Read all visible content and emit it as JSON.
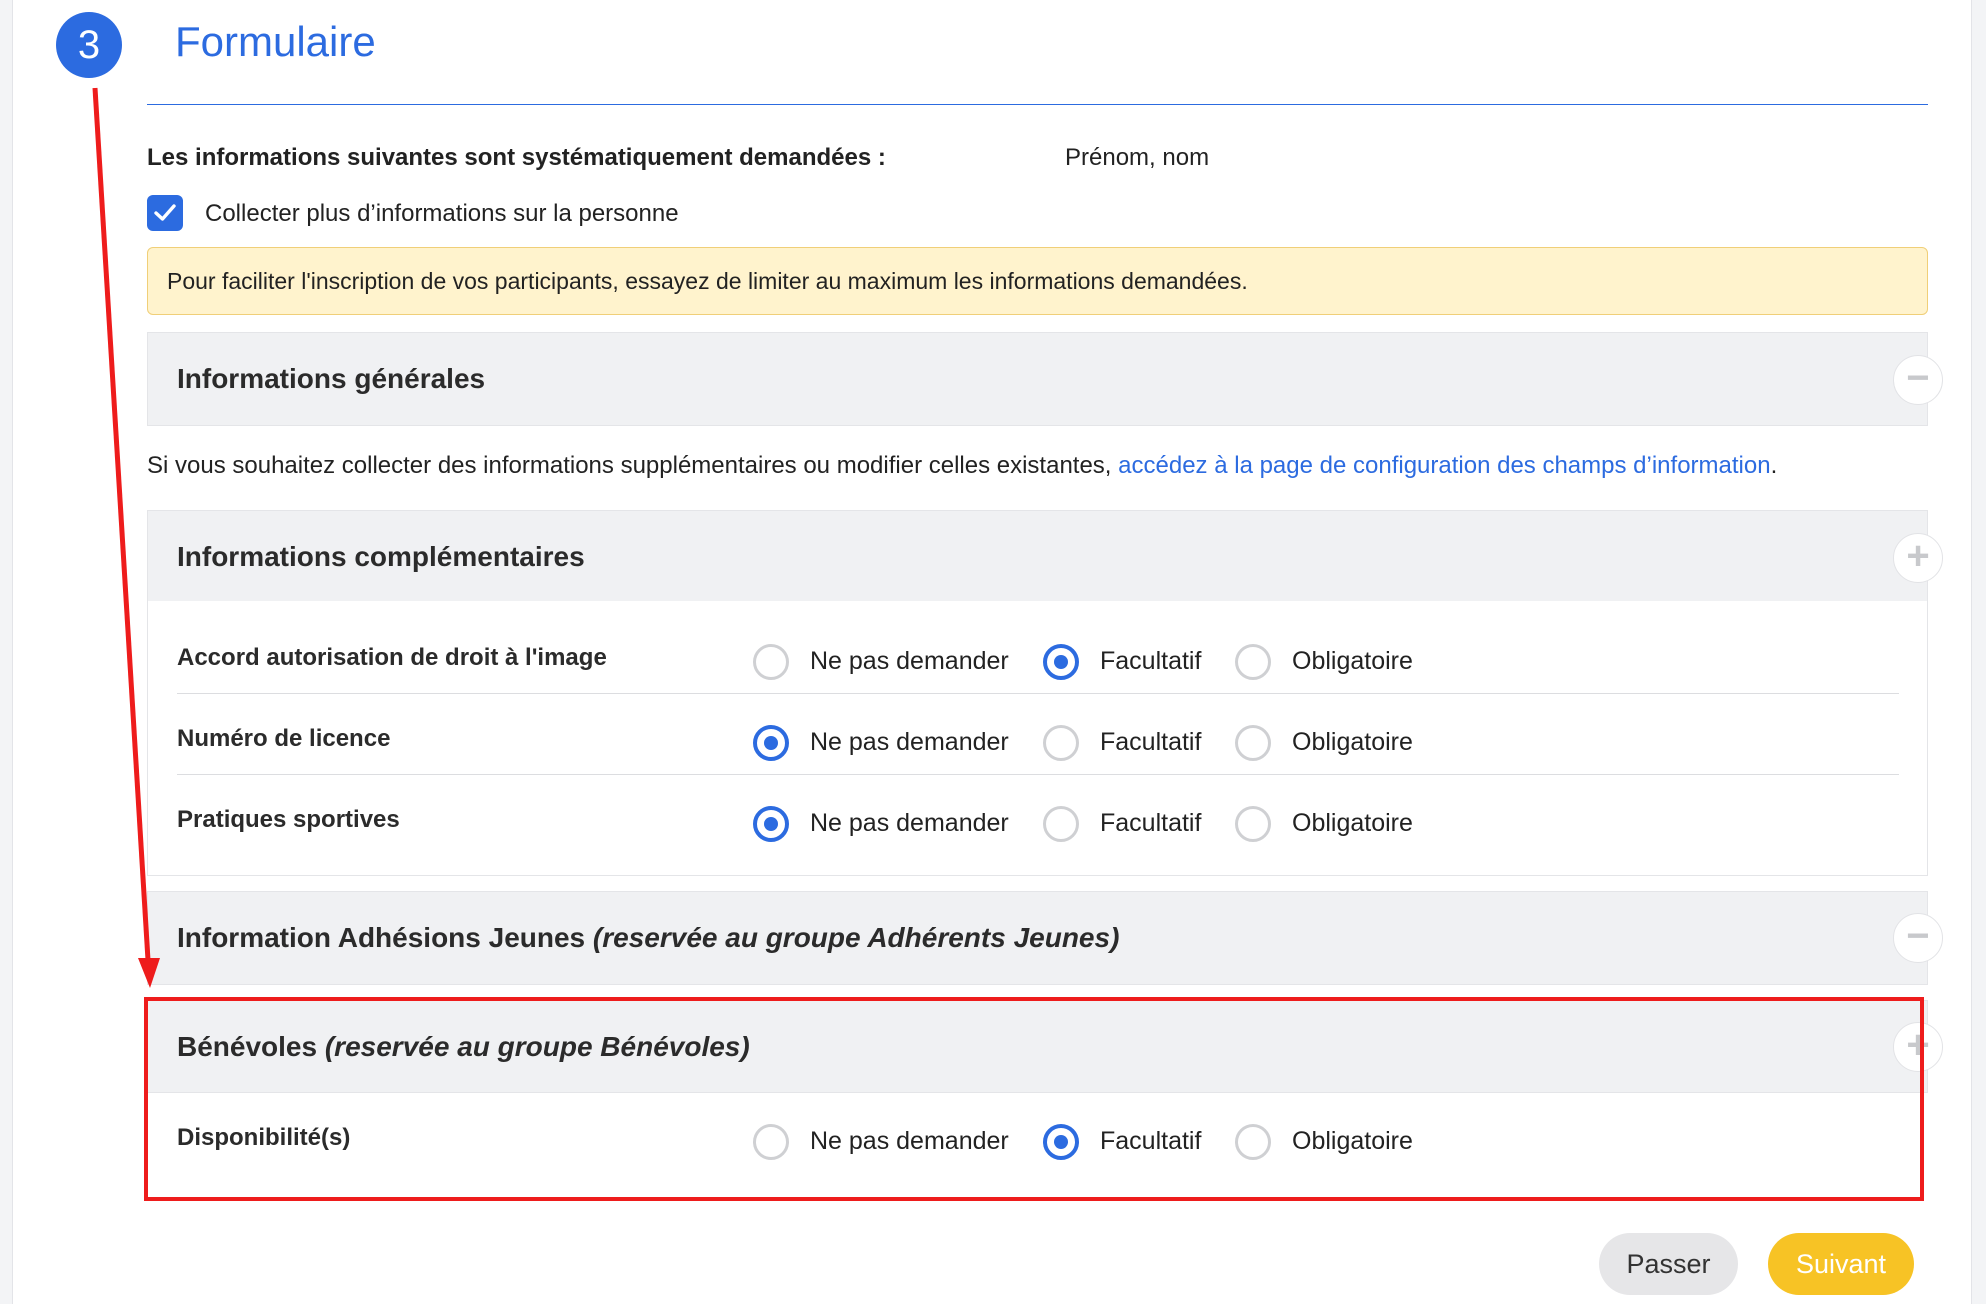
{
  "step": {
    "number": "3",
    "title": "Formulaire"
  },
  "required_info": {
    "label": "Les informations suivantes sont systématiquement demandées :",
    "value": "Prénom, nom"
  },
  "collect_more": {
    "label": "Collecter plus d’informations sur la personne",
    "checked": true
  },
  "tip": "Pour faciliter l'inscription de vos participants, essayez de limiter au maximum les informations demandées.",
  "sections": {
    "general": {
      "title": "Informations générales",
      "toggle": "−"
    },
    "config_text": {
      "before": "Si vous souhaitez collecter des informations supplémentaires ou modifier celles existantes, ",
      "link": "accédez à la page de configuration des champs d’information",
      "after": "."
    },
    "complementary": {
      "title": "Informations complémentaires",
      "toggle": "+",
      "fields": [
        {
          "label": "Accord autorisation de droit à l'image",
          "selected": "Facultatif"
        },
        {
          "label": "Numéro de licence",
          "selected": "Ne pas demander"
        },
        {
          "label": "Pratiques sportives",
          "selected": "Ne pas demander"
        }
      ]
    },
    "youth": {
      "title": "Information Adhésions Jeunes",
      "restriction": "(reservée au groupe Adhérents Jeunes)",
      "toggle": "−"
    },
    "volunteers": {
      "title": "Bénévoles",
      "restriction": "(reservée au groupe Bénévoles)",
      "toggle": "+",
      "fields": [
        {
          "label": "Disponibilité(s)",
          "selected": "Facultatif"
        }
      ]
    }
  },
  "options": {
    "none": "Ne pas demander",
    "optional": "Facultatif",
    "mandatory": "Obligatoire"
  },
  "buttons": {
    "skip": "Passer",
    "next": "Suivant"
  },
  "colors": {
    "accent": "#2c6be0",
    "annotation": "#ee1c1c",
    "primary_button": "#f7c325",
    "tip_bg": "#fff3cd"
  }
}
